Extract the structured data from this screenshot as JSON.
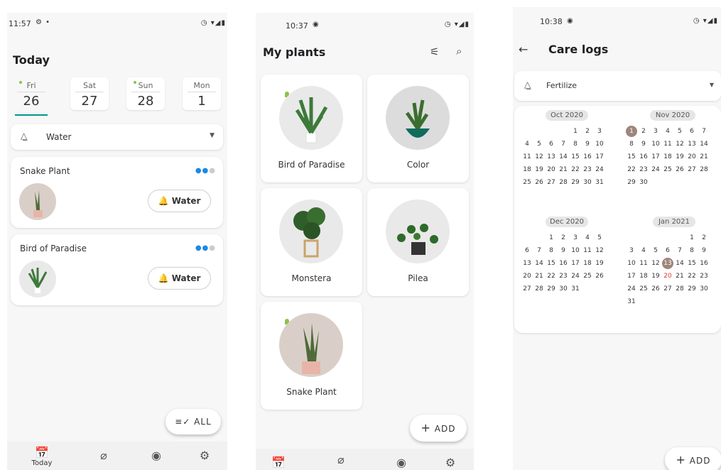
{
  "screen1": {
    "status": {
      "time": "11:57",
      "icons": "◷ ▾◢▮"
    },
    "title": "Today",
    "days": [
      {
        "name": "Fri",
        "num": "26",
        "dot": true,
        "selected": true
      },
      {
        "name": "Sat",
        "num": "27",
        "dot": false
      },
      {
        "name": "Sun",
        "num": "28",
        "dot": true
      },
      {
        "name": "Mon",
        "num": "1",
        "dot": false
      }
    ],
    "filter": {
      "label": "Water"
    },
    "tasks": [
      {
        "plant": "Snake Plant",
        "action": "Water"
      },
      {
        "plant": "Bird of Paradise",
        "action": "Water"
      }
    ],
    "fab": {
      "label": "ALL"
    },
    "nav": {
      "today_label": "Today"
    }
  },
  "screen2": {
    "status": {
      "time": "10:37",
      "icons": "◷ ▾◢▮"
    },
    "title": "My plants",
    "plants": [
      {
        "name": "Bird of Paradise"
      },
      {
        "name": "Color"
      },
      {
        "name": "Monstera"
      },
      {
        "name": "Pilea"
      },
      {
        "name": "Snake Plant"
      }
    ],
    "fab": {
      "label": "ADD"
    }
  },
  "screen3": {
    "status": {
      "time": "10:38",
      "icons": "◷ ▾◢▮"
    },
    "title": "Care logs",
    "filter": {
      "label": "Fertilize"
    },
    "months": [
      {
        "label": "Oct 2020"
      },
      {
        "label": "Nov 2020"
      },
      {
        "label": "Dec 2020"
      },
      {
        "label": "Jan 2021"
      }
    ],
    "fab": {
      "label": "ADD"
    }
  }
}
